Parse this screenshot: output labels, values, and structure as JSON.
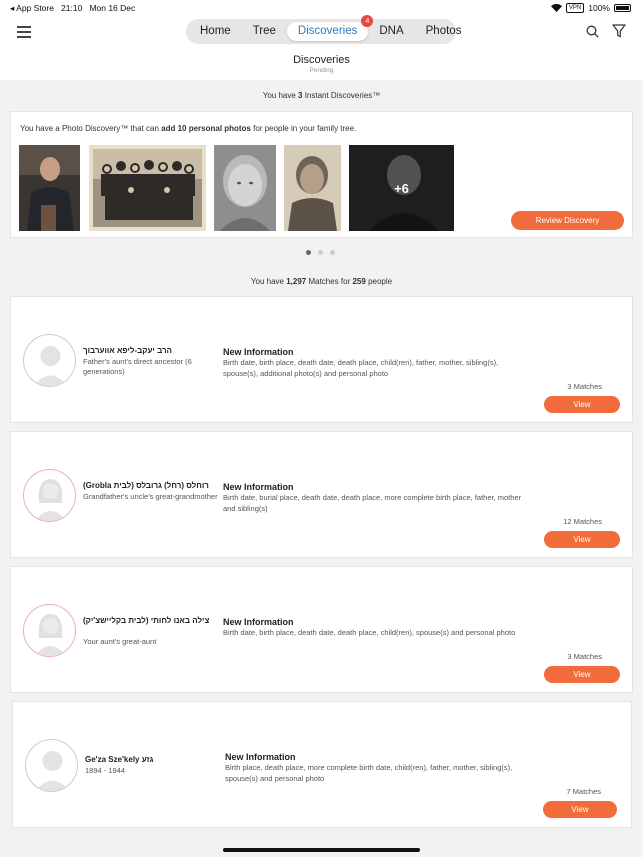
{
  "status_bar": {
    "back_app": "◂ App Store",
    "time": "21:10",
    "date": "Mon 16 Dec",
    "vpn": "VPN",
    "battery": "100%"
  },
  "nav": {
    "tabs": [
      {
        "label": "Home"
      },
      {
        "label": "Tree"
      },
      {
        "label": "Discoveries",
        "badge": "4",
        "active": true
      },
      {
        "label": "DNA"
      },
      {
        "label": "Photos"
      }
    ]
  },
  "page": {
    "title": "Discoveries",
    "subtitle": "Pending"
  },
  "instant": {
    "header_prefix": "You have ",
    "header_count": "3",
    "header_suffix": " Instant Discoveries™",
    "text_prefix": "You have a Photo Discovery™ that can ",
    "text_bold": "add 10 personal photos",
    "text_suffix": " for people in your family tree.",
    "more_count": "+6",
    "review_label": "Review Discovery"
  },
  "matches_summary": {
    "prefix": "You have ",
    "matches": "1,297",
    "middle": " Matches for ",
    "people": "259",
    "suffix": " people"
  },
  "matches": [
    {
      "name": "הרב יעקב-ליפא אווערבוך",
      "relation": "Father's aunt's direct ancestor (6 generations)",
      "info_title": "New Information",
      "info_body": "Birth date, birth place, death date, death place, child(ren), father, mother, sibling(s), spouse(s), additional photo(s) and personal photo",
      "count": "3 Matches",
      "view_label": "View",
      "gender": "male"
    },
    {
      "name": "(Grobla רוחלס (רחל) גרובלס (לבית",
      "relation": "Grandfather's uncle's great-grandmother",
      "info_title": "New Information",
      "info_body": "Birth date, burial place, death date, death place, more complete birth place, father, mother and sibling(s)",
      "count": "12 Matches",
      "view_label": "View",
      "gender": "female"
    },
    {
      "name": "צילה באנו לחותי (לבית בקליישצ'יק)",
      "relation": "Your aunt's great-aunt",
      "info_title": "New Information",
      "info_body": "Birth date, birth place, death date, death place, child(ren), spouse(s) and personal photo",
      "count": "3 Matches",
      "view_label": "View",
      "gender": "female"
    },
    {
      "name": "Ge'za Sze'kely גזע",
      "relation": "1894 - 1944",
      "info_title": "New Information",
      "info_body": "Birth place, death place, more complete birth date, child(ren), father, mother, sibling(s), spouse(s) and personal photo",
      "count": "7 Matches",
      "view_label": "View",
      "gender": "male"
    }
  ],
  "colors": {
    "accent_orange": "#f26b3a",
    "active_tab_blue": "#2b7bbf",
    "badge_red": "#e8483b"
  }
}
